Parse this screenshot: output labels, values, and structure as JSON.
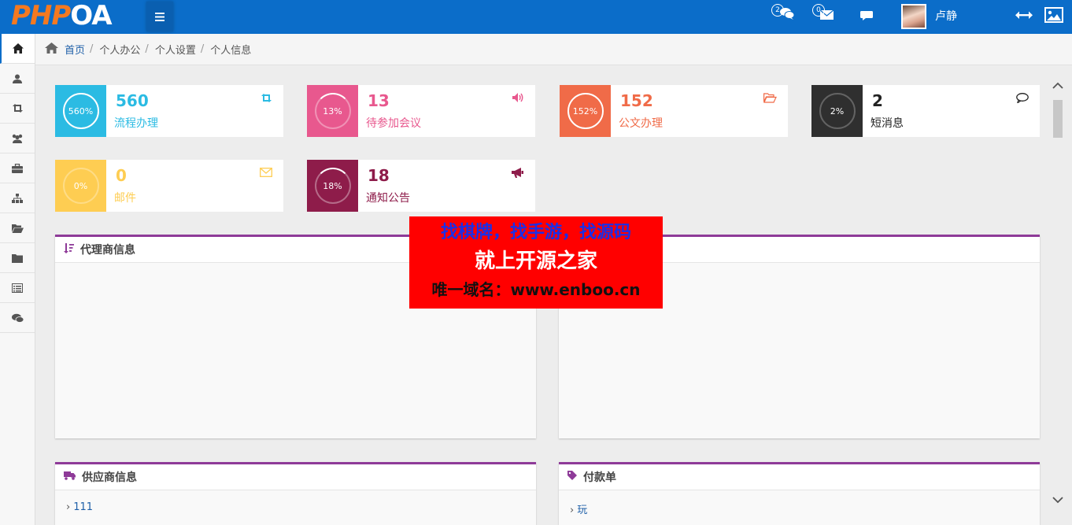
{
  "header": {
    "logo_php": "PHP",
    "logo_oa": "OA",
    "chat_badge": "2",
    "mail_badge": "0",
    "username": "卢静"
  },
  "breadcrumb": {
    "home": "首页",
    "items": [
      "个人办公",
      "个人设置",
      "个人信息"
    ]
  },
  "cards": [
    {
      "percent": "560%",
      "value": "560",
      "label": "流程办理",
      "color": "#2bbbe3"
    },
    {
      "percent": "13%",
      "value": "13",
      "label": "待参加会议",
      "color": "#e8588e"
    },
    {
      "percent": "152%",
      "value": "152",
      "label": "公文办理",
      "color": "#f06b48"
    },
    {
      "percent": "2%",
      "value": "2",
      "label": "短消息",
      "color": "#2f2f2f"
    },
    {
      "percent": "0%",
      "value": "0",
      "label": "邮件",
      "color": "#fecd52"
    },
    {
      "percent": "18%",
      "value": "18",
      "label": "通知公告",
      "color": "#8e1c4a"
    }
  ],
  "panels": {
    "agent": {
      "title": "代理商信息"
    },
    "supplier": {
      "title": "供应商信息",
      "rows": [
        "111"
      ]
    },
    "payment": {
      "title": "付款单",
      "rows": [
        "玩"
      ]
    }
  },
  "watermark": {
    "line1": "找棋牌，找手游，找源码",
    "line2": "就上开源之家",
    "line3": "唯一域名：www.enboo.cn"
  },
  "colors": {
    "topbar": "#0b6dc9",
    "panel_accent": "#8e3a98",
    "watermark_bg": "#ff0000"
  }
}
